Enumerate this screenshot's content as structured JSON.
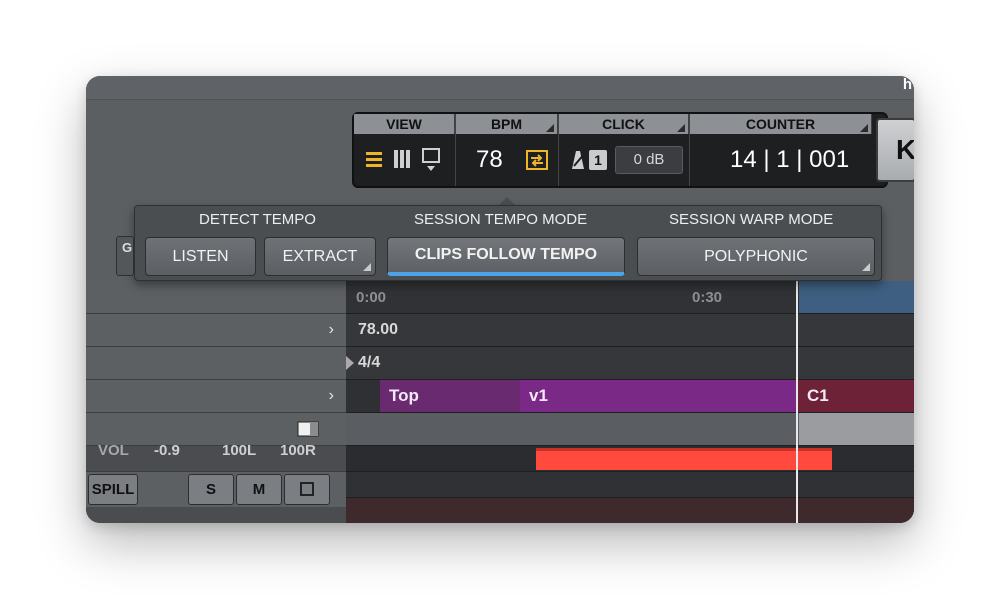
{
  "app": {
    "corner_label": "h"
  },
  "transport": {
    "view": {
      "label": "VIEW"
    },
    "bpm": {
      "label": "BPM",
      "value": "78"
    },
    "click": {
      "label": "CLICK",
      "number": "1",
      "level": "0 dB"
    },
    "counter": {
      "label": "COUNTER",
      "value": "14 | 1 | 001"
    },
    "side_button_label": "K"
  },
  "popup": {
    "detect_tempo": {
      "title": "DETECT TEMPO",
      "listen": "LISTEN",
      "extract": "EXTRACT"
    },
    "session_tempo_mode": {
      "title": "SESSION TEMPO MODE",
      "button": "CLIPS FOLLOW TEMPO"
    },
    "session_warp_mode": {
      "title": "SESSION WARP MODE",
      "button": "POLYPHONIC"
    }
  },
  "left_stub": "G",
  "timeline": {
    "ruler": {
      "start": "0:00",
      "mark": "0:30"
    },
    "tempo_value": "78.00",
    "signature": "4/4",
    "clips": [
      {
        "name": "Top",
        "color": "#6a2a70"
      },
      {
        "name": "v1",
        "color": "#7a2a86"
      },
      {
        "name": "C1",
        "color": "#6e2238"
      }
    ]
  },
  "mixer": {
    "vol_label": "VOL",
    "vol_value": "-0.9",
    "pan_left": "100L",
    "pan_right": "100R",
    "spill": "SPILL",
    "solo": "S",
    "mute": "M"
  },
  "colors": {
    "accent_orange": "#f0b428",
    "accent_blue": "#4da3e8",
    "region_red": "#ff4a3d"
  }
}
